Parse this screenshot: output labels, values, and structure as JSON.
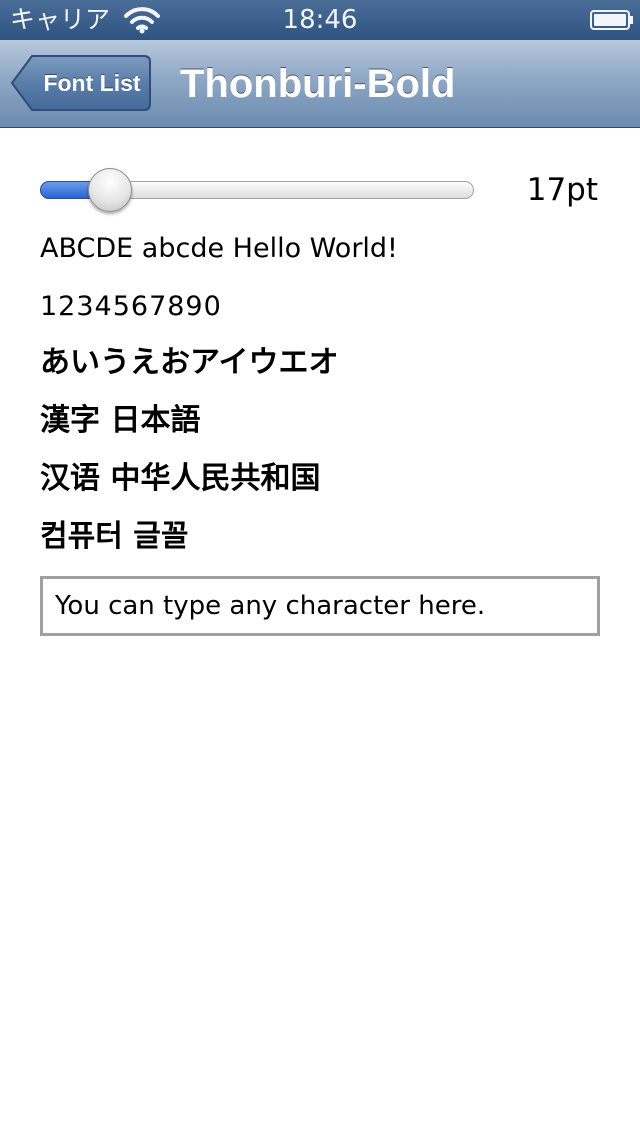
{
  "status_bar": {
    "carrier": "キャリア",
    "time": "18:46",
    "wifi_icon": "wifi-icon",
    "battery_icon": "battery-icon"
  },
  "nav_bar": {
    "back_label": "Font List",
    "title": "Thonburi-Bold",
    "tint": "#6b8bb0"
  },
  "font_size_slider": {
    "value": 17,
    "min": 8,
    "max": 64,
    "fill_color": "#2a63d4"
  },
  "font_size_label": "17pt",
  "samples": {
    "latin": "ABCDE abcde Hello World!",
    "digits": "1234567890",
    "kana": "あいうえおアイウエオ",
    "kanji": "漢字 日本語",
    "hanzi": "汉语 中华人民共和国",
    "hangul": "컴퓨터 글꼴"
  },
  "text_field": {
    "value": "You can type any character here.",
    "placeholder": ""
  }
}
